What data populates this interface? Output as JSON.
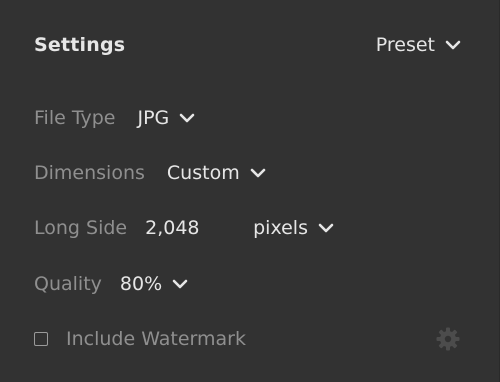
{
  "panel": {
    "title": "Settings",
    "preset_label": "Preset"
  },
  "file_type": {
    "label": "File Type",
    "value": "JPG"
  },
  "dimensions": {
    "label": "Dimensions",
    "value": "Custom"
  },
  "long_side": {
    "label": "Long Side",
    "value": "2,048",
    "unit": "pixels"
  },
  "quality": {
    "label": "Quality",
    "value": "80%"
  },
  "watermark": {
    "label": "Include Watermark",
    "checked": false
  },
  "icons": {
    "chevron": "chevron-down-icon",
    "settings": "gear-icon"
  },
  "colors": {
    "background": "#323232",
    "text_primary": "#e6e6e6",
    "text_secondary": "#8f8f8f",
    "gear_disabled": "#4c4c4c"
  }
}
